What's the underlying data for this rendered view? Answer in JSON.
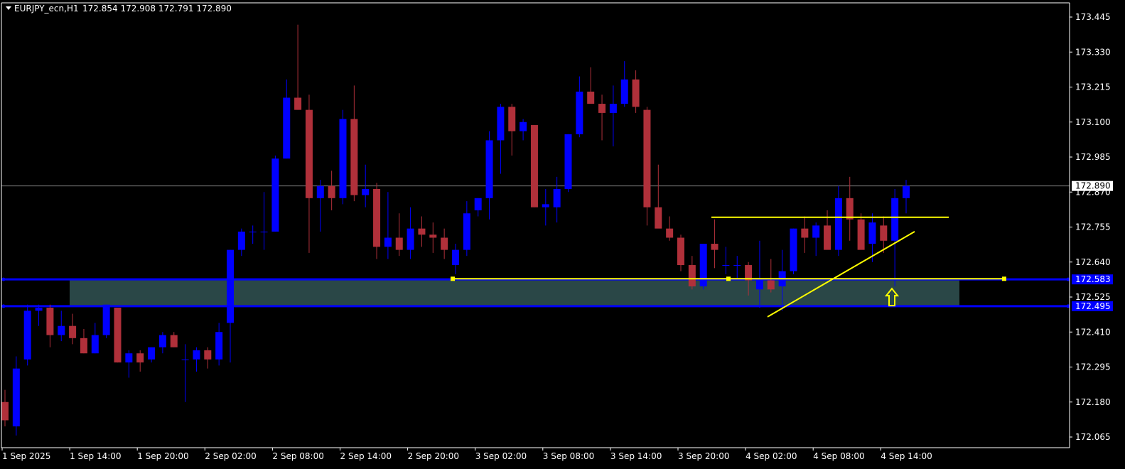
{
  "header": {
    "symbol": "EURJPY_ecn,H1",
    "ohlc": "172.854 172.908 172.791 172.890"
  },
  "colors": {
    "background": "#000000",
    "bull": "#0000ff",
    "bear": "#b0303a",
    "wick_bull": "#0000ff",
    "wick_bear": "#b0303a",
    "grid_text": "#ffffff",
    "zone": "#2f4f4f",
    "zone_line": "#0000ff",
    "annotation": "#ffff00",
    "price_line": "#808080"
  },
  "chart_data": {
    "type": "candlestick",
    "symbol": "EURJPY_ecn",
    "timeframe": "H1",
    "y_ticks": [
      "173.445",
      "173.330",
      "173.215",
      "173.100",
      "172.985",
      "172.870",
      "172.755",
      "172.640",
      "172.525",
      "172.410",
      "172.295",
      "172.180",
      "172.065"
    ],
    "ylim": [
      172.02,
      173.5
    ],
    "x_ticks": [
      "1 Sep 2025",
      "1 Sep 14:00",
      "1 Sep 20:00",
      "2 Sep 02:00",
      "2 Sep 08:00",
      "2 Sep 14:00",
      "2 Sep 20:00",
      "3 Sep 02:00",
      "3 Sep 08:00",
      "3 Sep 14:00",
      "3 Sep 20:00",
      "4 Sep 02:00",
      "4 Sep 08:00",
      "4 Sep 14:00"
    ],
    "candles": [
      {
        "o": 172.18,
        "h": 172.22,
        "l": 172.1,
        "c": 172.12
      },
      {
        "o": 172.1,
        "h": 172.33,
        "l": 172.07,
        "c": 172.29
      },
      {
        "o": 172.32,
        "h": 172.5,
        "l": 172.3,
        "c": 172.48
      },
      {
        "o": 172.48,
        "h": 172.5,
        "l": 172.43,
        "c": 172.49
      },
      {
        "o": 172.49,
        "h": 172.5,
        "l": 172.36,
        "c": 172.4
      },
      {
        "o": 172.4,
        "h": 172.48,
        "l": 172.38,
        "c": 172.43
      },
      {
        "o": 172.43,
        "h": 172.47,
        "l": 172.37,
        "c": 172.39
      },
      {
        "o": 172.39,
        "h": 172.42,
        "l": 172.34,
        "c": 172.34
      },
      {
        "o": 172.34,
        "h": 172.44,
        "l": 172.34,
        "c": 172.4
      },
      {
        "o": 172.4,
        "h": 172.5,
        "l": 172.39,
        "c": 172.5
      },
      {
        "o": 172.49,
        "h": 172.49,
        "l": 172.31,
        "c": 172.31
      },
      {
        "o": 172.31,
        "h": 172.35,
        "l": 172.26,
        "c": 172.34
      },
      {
        "o": 172.34,
        "h": 172.35,
        "l": 172.28,
        "c": 172.31
      },
      {
        "o": 172.32,
        "h": 172.36,
        "l": 172.31,
        "c": 172.36
      },
      {
        "o": 172.36,
        "h": 172.41,
        "l": 172.34,
        "c": 172.4
      },
      {
        "o": 172.4,
        "h": 172.41,
        "l": 172.36,
        "c": 172.36
      },
      {
        "o": 172.32,
        "h": 172.37,
        "l": 172.18,
        "c": 172.32
      },
      {
        "o": 172.32,
        "h": 172.36,
        "l": 172.28,
        "c": 172.35
      },
      {
        "o": 172.35,
        "h": 172.36,
        "l": 172.29,
        "c": 172.32
      },
      {
        "o": 172.32,
        "h": 172.44,
        "l": 172.3,
        "c": 172.41
      },
      {
        "o": 172.44,
        "h": 172.68,
        "l": 172.31,
        "c": 172.68
      },
      {
        "o": 172.68,
        "h": 172.75,
        "l": 172.66,
        "c": 172.74
      },
      {
        "o": 172.74,
        "h": 172.76,
        "l": 172.7,
        "c": 172.74
      },
      {
        "o": 172.74,
        "h": 172.87,
        "l": 172.68,
        "c": 172.74
      },
      {
        "o": 172.74,
        "h": 172.99,
        "l": 172.74,
        "c": 172.98
      },
      {
        "o": 172.98,
        "h": 173.24,
        "l": 172.98,
        "c": 173.18
      },
      {
        "o": 173.18,
        "h": 173.42,
        "l": 173.14,
        "c": 173.14
      },
      {
        "o": 173.14,
        "h": 173.19,
        "l": 172.67,
        "c": 172.85
      },
      {
        "o": 172.85,
        "h": 172.91,
        "l": 172.74,
        "c": 172.89
      },
      {
        "o": 172.89,
        "h": 172.94,
        "l": 172.81,
        "c": 172.85
      },
      {
        "o": 172.85,
        "h": 173.14,
        "l": 172.83,
        "c": 173.11
      },
      {
        "o": 173.11,
        "h": 173.22,
        "l": 172.84,
        "c": 172.86
      },
      {
        "o": 172.86,
        "h": 172.96,
        "l": 172.82,
        "c": 172.88
      },
      {
        "o": 172.88,
        "h": 172.9,
        "l": 172.65,
        "c": 172.69
      },
      {
        "o": 172.69,
        "h": 172.87,
        "l": 172.65,
        "c": 172.72
      },
      {
        "o": 172.72,
        "h": 172.8,
        "l": 172.66,
        "c": 172.68
      },
      {
        "o": 172.68,
        "h": 172.82,
        "l": 172.65,
        "c": 172.75
      },
      {
        "o": 172.75,
        "h": 172.79,
        "l": 172.69,
        "c": 172.73
      },
      {
        "o": 172.73,
        "h": 172.77,
        "l": 172.67,
        "c": 172.72
      },
      {
        "o": 172.72,
        "h": 172.75,
        "l": 172.65,
        "c": 172.68
      },
      {
        "o": 172.63,
        "h": 172.7,
        "l": 172.6,
        "c": 172.68
      },
      {
        "o": 172.68,
        "h": 172.84,
        "l": 172.66,
        "c": 172.8
      },
      {
        "o": 172.81,
        "h": 172.85,
        "l": 172.79,
        "c": 172.85
      },
      {
        "o": 172.85,
        "h": 173.07,
        "l": 172.78,
        "c": 173.04
      },
      {
        "o": 173.04,
        "h": 173.16,
        "l": 172.93,
        "c": 173.15
      },
      {
        "o": 173.15,
        "h": 173.16,
        "l": 172.99,
        "c": 173.07
      },
      {
        "o": 173.07,
        "h": 173.11,
        "l": 173.04,
        "c": 173.1
      },
      {
        "o": 173.09,
        "h": 173.09,
        "l": 172.82,
        "c": 172.82
      },
      {
        "o": 172.82,
        "h": 172.88,
        "l": 172.76,
        "c": 172.83
      },
      {
        "o": 172.82,
        "h": 172.92,
        "l": 172.77,
        "c": 172.88
      },
      {
        "o": 172.88,
        "h": 173.06,
        "l": 172.87,
        "c": 173.06
      },
      {
        "o": 173.06,
        "h": 173.25,
        "l": 173.05,
        "c": 173.2
      },
      {
        "o": 173.2,
        "h": 173.28,
        "l": 173.16,
        "c": 173.16
      },
      {
        "o": 173.16,
        "h": 173.19,
        "l": 173.04,
        "c": 173.13
      },
      {
        "o": 173.13,
        "h": 173.22,
        "l": 173.02,
        "c": 173.16
      },
      {
        "o": 173.16,
        "h": 173.3,
        "l": 173.15,
        "c": 173.24
      },
      {
        "o": 173.24,
        "h": 173.27,
        "l": 173.13,
        "c": 173.15
      },
      {
        "o": 173.14,
        "h": 173.15,
        "l": 172.76,
        "c": 172.82
      },
      {
        "o": 172.82,
        "h": 172.96,
        "l": 172.76,
        "c": 172.75
      },
      {
        "o": 172.75,
        "h": 172.79,
        "l": 172.71,
        "c": 172.72
      },
      {
        "o": 172.72,
        "h": 172.73,
        "l": 172.61,
        "c": 172.63
      },
      {
        "o": 172.63,
        "h": 172.66,
        "l": 172.55,
        "c": 172.56
      },
      {
        "o": 172.56,
        "h": 172.7,
        "l": 172.55,
        "c": 172.7
      },
      {
        "o": 172.7,
        "h": 172.78,
        "l": 172.62,
        "c": 172.68
      },
      {
        "o": 172.63,
        "h": 172.69,
        "l": 172.6,
        "c": 172.63
      },
      {
        "o": 172.63,
        "h": 172.66,
        "l": 172.58,
        "c": 172.63
      },
      {
        "o": 172.63,
        "h": 172.64,
        "l": 172.53,
        "c": 172.58
      },
      {
        "o": 172.55,
        "h": 172.71,
        "l": 172.49,
        "c": 172.58
      },
      {
        "o": 172.58,
        "h": 172.65,
        "l": 172.54,
        "c": 172.55
      },
      {
        "o": 172.56,
        "h": 172.68,
        "l": 172.48,
        "c": 172.61
      },
      {
        "o": 172.61,
        "h": 172.75,
        "l": 172.6,
        "c": 172.75
      },
      {
        "o": 172.75,
        "h": 172.79,
        "l": 172.67,
        "c": 172.72
      },
      {
        "o": 172.72,
        "h": 172.77,
        "l": 172.66,
        "c": 172.76
      },
      {
        "o": 172.76,
        "h": 172.81,
        "l": 172.72,
        "c": 172.68
      },
      {
        "o": 172.68,
        "h": 172.89,
        "l": 172.66,
        "c": 172.85
      },
      {
        "o": 172.85,
        "h": 172.92,
        "l": 172.71,
        "c": 172.78
      },
      {
        "o": 172.78,
        "h": 172.8,
        "l": 172.69,
        "c": 172.68
      },
      {
        "o": 172.7,
        "h": 172.8,
        "l": 172.64,
        "c": 172.77
      },
      {
        "o": 172.76,
        "h": 172.79,
        "l": 172.67,
        "c": 172.71
      },
      {
        "o": 172.71,
        "h": 172.88,
        "l": 172.56,
        "c": 172.85
      },
      {
        "o": 172.85,
        "h": 172.91,
        "l": 172.8,
        "c": 172.89
      }
    ],
    "zone": {
      "top": 172.583,
      "bottom": 172.495,
      "labels": [
        "172.583",
        "172.495"
      ]
    },
    "current_price": {
      "value": 172.89,
      "label": "172.890"
    },
    "horizontal_lines": [
      {
        "y": 172.787
      },
      {
        "y": 172.585
      }
    ],
    "trendline": {
      "from": {
        "candle": 68,
        "y": 172.46
      },
      "to": {
        "candle": 81,
        "y": 172.74
      }
    },
    "arrow_marker": {
      "candle": 80,
      "y": 172.52,
      "direction": "up"
    }
  }
}
